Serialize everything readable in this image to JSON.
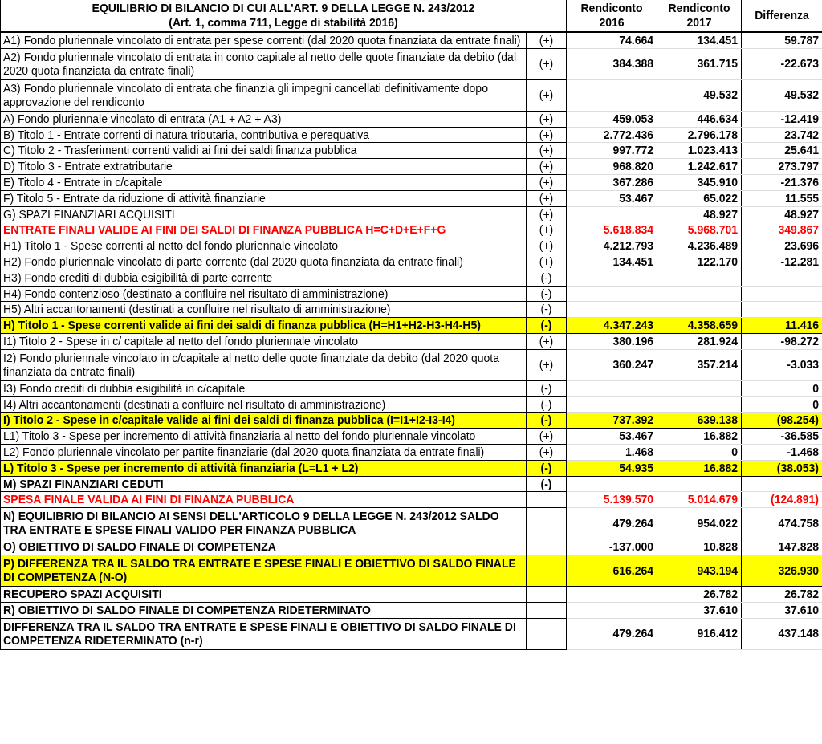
{
  "table": {
    "title": "EQUILIBRIO DI BILANCIO DI CUI ALL'ART. 9 DELLA LEGGE N. 243/2012",
    "subtitle": "(Art. 1, comma 711, Legge di stabilità 2016)",
    "columns": [
      "Rendiconto 2016",
      "Rendiconto 2017",
      "Differenza"
    ],
    "rows": [
      {
        "kind": "plain",
        "label": "A1) Fondo pluriennale vincolato di entrata per spese correnti (dal 2020 quota finanziata da entrate finali)",
        "sign": "(+)",
        "rendiconto_2016": "74.664",
        "rendiconto_2017": "134.451",
        "differenza": "59.787"
      },
      {
        "kind": "plain",
        "label": "A2) Fondo pluriennale vincolato di entrata in conto capitale  al netto delle quote finanziate da debito (dal 2020 quota finanziata da entrate finali)",
        "sign": "(+)",
        "rendiconto_2016": "384.388",
        "rendiconto_2017": "361.715",
        "differenza": "-22.673"
      },
      {
        "kind": "plain",
        "label": "A3) Fondo pluriennale vincolato di entrata che finanzia gli impegni cancellati definitivamente dopo approvazione del rendiconto",
        "sign": "(+)",
        "rendiconto_2017": "49.532",
        "differenza": "49.532"
      },
      {
        "kind": "plain",
        "label": "A) Fondo pluriennale vincolato di entrata (A1 + A2 + A3)",
        "sign": "(+)",
        "rendiconto_2016": "459.053",
        "rendiconto_2017": "446.634",
        "differenza": "-12.419"
      },
      {
        "kind": "plain",
        "label": "B) Titolo 1 - Entrate correnti di natura tributaria, contributiva e perequativa",
        "sign": "(+)",
        "rendiconto_2016": "2.772.436",
        "rendiconto_2017": "2.796.178",
        "differenza": "23.742"
      },
      {
        "kind": "plain",
        "label": "C) Titolo 2 - Trasferimenti correnti  validi ai fini dei saldi finanza pubblica",
        "sign": "(+)",
        "rendiconto_2016": "997.772",
        "rendiconto_2017": "1.023.413",
        "differenza": "25.641"
      },
      {
        "kind": "plain",
        "label": "D) Titolo 3 - Entrate extratributarie",
        "sign": "(+)",
        "rendiconto_2016": "968.820",
        "rendiconto_2017": "1.242.617",
        "differenza": "273.797"
      },
      {
        "kind": "plain",
        "label": "E) Titolo 4 - Entrate in c/capitale",
        "sign": "(+)",
        "rendiconto_2016": "367.286",
        "rendiconto_2017": "345.910",
        "differenza": "-21.376"
      },
      {
        "kind": "plain",
        "label": "F) Titolo 5 - Entrate da riduzione di attività finanziarie",
        "sign": "(+)",
        "rendiconto_2016": "53.467",
        "rendiconto_2017": "65.022",
        "differenza": "11.555"
      },
      {
        "kind": "plain",
        "label": "G)  SPAZI FINANZIARI ACQUISITI",
        "sign": "(+)",
        "rendiconto_2017": "48.927",
        "differenza": "48.927"
      },
      {
        "kind": "final",
        "label": "ENTRATE FINALI VALIDE AI FINI DEI SALDI DI FINANZA PUBBLICA H=C+D+E+F+G",
        "sign": "(+)",
        "rendiconto_2016": "5.618.834",
        "rendiconto_2017": "5.968.701",
        "differenza": "349.867"
      },
      {
        "kind": "plain",
        "label": "H1) Titolo 1 - Spese correnti al netto del fondo pluriennale vincolato",
        "sign": "(+)",
        "rendiconto_2016": "4.212.793",
        "rendiconto_2017": "4.236.489",
        "differenza": "23.696"
      },
      {
        "kind": "plain",
        "label": "H2)  Fondo pluriennale vincolato di parte corrente (dal 2020 quota finanziata da entrate finali)",
        "sign": "(+)",
        "rendiconto_2016": "134.451",
        "rendiconto_2017": "122.170",
        "differenza": "-12.281"
      },
      {
        "kind": "plain",
        "label": "H3) Fondo crediti di dubbia esigibilità di parte corrente",
        "sign": "(-)"
      },
      {
        "kind": "plain",
        "label": "H4) Fondo contenzioso (destinato a confluire nel risultato di amministrazione)",
        "sign": "(-)"
      },
      {
        "kind": "plain",
        "label": "H5) Altri accantonamenti (destinati a confluire nel risultato di amministrazione)",
        "sign": "(-)"
      },
      {
        "kind": "subtotal",
        "label": "H) Titolo 1 - Spese correnti valide ai fini dei saldi di finanza pubblica (H=H1+H2-H3-H4-H5)",
        "sign": "(-)",
        "rendiconto_2016": "4.347.243",
        "rendiconto_2017": "4.358.659",
        "differenza": "11.416"
      },
      {
        "kind": "plain",
        "label": "I1) Titolo 2 - Spese in c/ capitale al netto del fondo pluriennale vincolato",
        "sign": "(+)",
        "rendiconto_2016": "380.196",
        "rendiconto_2017": "281.924",
        "differenza": "-98.272"
      },
      {
        "kind": "plain",
        "label": "I2) Fondo pluriennale vincolato in c/capitale al netto delle quote finanziate da debito (dal 2020 quota finanziata da entrate finali)",
        "sign": "(+)",
        "rendiconto_2016": "360.247",
        "rendiconto_2017": "357.214",
        "differenza": "-3.033"
      },
      {
        "kind": "plain",
        "label": "I3) Fondo crediti di dubbia esigibilità in c/capitale",
        "sign": "(-)",
        "differenza": "0"
      },
      {
        "kind": "plain",
        "label": "I4) Altri accantonamenti (destinati a confluire nel risultato di amministrazione)",
        "sign": "(-)",
        "differenza": "0"
      },
      {
        "kind": "subtotal",
        "label": "I) Titolo 2 - Spese in c/capitale valide ai fini dei saldi di finanza pubblica (I=I1+I2-I3-I4)",
        "sign": "(-)",
        "rendiconto_2016": "737.392",
        "rendiconto_2017": "639.138",
        "differenza": "(98.254)"
      },
      {
        "kind": "plain",
        "label": "L1) Titolo 3 - Spese per incremento di attività finanziaria al netto del fondo pluriennale vincolato",
        "sign": "(+)",
        "rendiconto_2016": "53.467",
        "rendiconto_2017": "16.882",
        "differenza": "-36.585"
      },
      {
        "kind": "plain",
        "label": "L2) Fondo pluriennale vincolato per partite finanziarie (dal 2020 quota finanziata da entrate finali)",
        "sign": "(+)",
        "rendiconto_2016": "1.468",
        "rendiconto_2017": "0",
        "differenza": "-1.468"
      },
      {
        "kind": "subtotal",
        "label": "L) Titolo 3 - Spese per incremento di attività finanziaria (L=L1 + L2)",
        "sign": "(-)",
        "rendiconto_2016": "54.935",
        "rendiconto_2017": "16.882",
        "differenza": "(38.053)"
      },
      {
        "kind": "bold",
        "label": "M) SPAZI FINANZIARI CEDUTI",
        "sign": "(-)"
      },
      {
        "kind": "final",
        "label": "SPESA FINALE VALIDA AI FINI DI FINANZA PUBBLICA",
        "rendiconto_2016": "5.139.570",
        "rendiconto_2017": "5.014.679",
        "differenza": "(124.891)"
      },
      {
        "kind": "bold",
        "label": "N) EQUILIBRIO DI BILANCIO  AI SENSI DELL'ARTICOLO 9 DELLA LEGGE N. 243/2012 SALDO TRA ENTRATE E SPESE FINALI  VALIDO PER FINANZA PUBBLICA",
        "rendiconto_2016": "479.264",
        "rendiconto_2017": "954.022",
        "differenza": "474.758"
      },
      {
        "kind": "bold",
        "label": "O) OBIETTIVO DI SALDO FINALE DI COMPETENZA",
        "rendiconto_2016": "-137.000",
        "rendiconto_2017": "10.828",
        "differenza": "147.828"
      },
      {
        "kind": "subtotal",
        "label": "P) DIFFERENZA TRA IL SALDO TRA ENTRATE E SPESE FINALI E OBIETTIVO DI SALDO FINALE DI COMPETENZA (N-O)",
        "rendiconto_2016": "616.264",
        "rendiconto_2017": "943.194",
        "differenza": "326.930"
      },
      {
        "kind": "bold",
        "label": "RECUPERO SPAZI ACQUISITI",
        "rendiconto_2017": "26.782",
        "differenza": "26.782"
      },
      {
        "kind": "bold",
        "label": "R) OBIETTIVO DI SALDO FINALE DI COMPETENZA RIDETERMINATO",
        "rendiconto_2017": "37.610",
        "differenza": "37.610"
      },
      {
        "kind": "bold",
        "label": "DIFFERENZA TRA IL SALDO TRA ENTRATE E SPESE FINALI E OBIETTIVO DI SALDO FINALE DI COMPETENZA RIDETERMINATO  (n-r)",
        "rendiconto_2016": "479.264",
        "rendiconto_2017": "916.412",
        "differenza": "437.148"
      }
    ]
  }
}
